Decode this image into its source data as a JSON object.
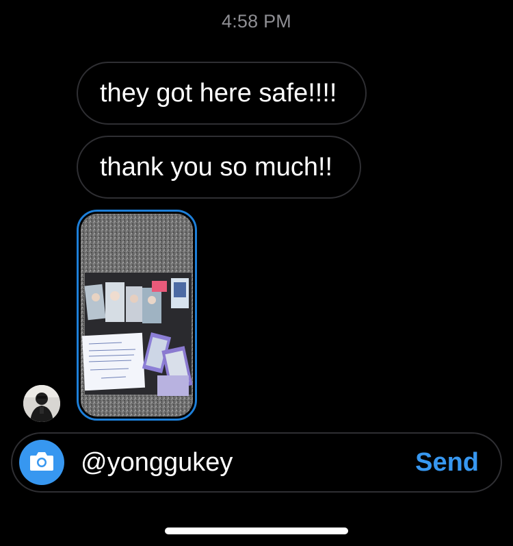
{
  "thread": {
    "timestamp": "4:58 PM",
    "messages": [
      {
        "text": "they got here safe!!!!"
      },
      {
        "text": "thank you so much!!"
      }
    ],
    "photo_message": {
      "description_icon": "photo-thumbnail"
    }
  },
  "composer": {
    "camera_icon": "camera-icon",
    "text": "@yonggukey",
    "send_label": "Send"
  },
  "colors": {
    "background": "#000000",
    "bubble_border": "#2f2f33",
    "accent": "#3797f0",
    "photo_border": "#1d7fd9",
    "timestamp": "#8e8e93"
  }
}
